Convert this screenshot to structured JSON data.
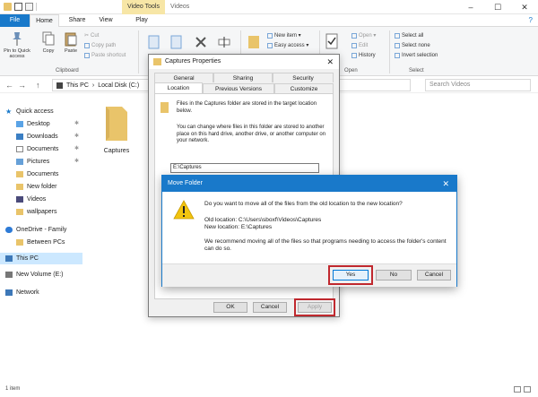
{
  "titlebar": {
    "context_tab": "Video Tools",
    "window_title": "Videos",
    "controls": [
      "–",
      "☐",
      "✕"
    ]
  },
  "tabs": {
    "file": "File",
    "home": "Home",
    "share": "Share",
    "view": "View",
    "play": "Play",
    "help": "?"
  },
  "ribbon": {
    "pin": "Pin to Quick access",
    "copy": "Copy",
    "paste": "Paste",
    "cut": "Cut",
    "copy_path": "Copy path",
    "paste_shortcut": "Paste shortcut",
    "clipboard_group": "Clipboard",
    "new_item": "New item ▾",
    "easy_access": "Easy access ▾",
    "open": "Open ▾",
    "edit": "Edit",
    "history": "History",
    "open_group": "Open",
    "select_all": "Select all",
    "select_none": "Select none",
    "invert_selection": "Invert selection",
    "select_group": "Select"
  },
  "address": {
    "back": "←",
    "forward": "→",
    "up": "↑",
    "crumbs": [
      "This PC",
      "›",
      "Local Disk (C:)"
    ],
    "search_placeholder": "Search Videos"
  },
  "navpane": {
    "items": [
      {
        "label": "Quick access",
        "pinned": false
      },
      {
        "label": "Desktop",
        "pinned": true
      },
      {
        "label": "Downloads",
        "pinned": true
      },
      {
        "label": "Documents",
        "pinned": true
      },
      {
        "label": "Pictures",
        "pinned": true
      },
      {
        "label": "Documents",
        "pinned": false
      },
      {
        "label": "New folder",
        "pinned": false
      },
      {
        "label": "Videos",
        "pinned": false
      },
      {
        "label": "wallpapers",
        "pinned": false
      },
      {
        "label": "OneDrive - Family",
        "pinned": false
      },
      {
        "label": "Between PCs",
        "pinned": false
      },
      {
        "label": "This PC",
        "pinned": false
      },
      {
        "label": "New Volume (E:)",
        "pinned": false
      },
      {
        "label": "Network",
        "pinned": false
      }
    ],
    "pin_glyph": "✱"
  },
  "content": {
    "folder_name": "Captures",
    "status": "1 item"
  },
  "properties": {
    "title": "Captures Properties",
    "close": "✕",
    "tabs_row1": [
      "General",
      "Sharing",
      "Security"
    ],
    "tabs_row2": [
      "Location",
      "Previous Versions",
      "Customize"
    ],
    "text1": "Files in the Captures folder are stored in the target location below.",
    "text2": "You can change where files in this folder are stored to another place on this hard drive, another drive, or another computer on your network.",
    "path_value": "E:\\Captures",
    "ok": "OK",
    "cancel": "Cancel",
    "apply": "Apply"
  },
  "move_dialog": {
    "title": "Move Folder",
    "close": "✕",
    "question": "Do you want to move all of the files from the old location to the new location?",
    "old_location": "Old location: C:\\Users\\sboxf\\Videos\\Captures",
    "new_location": "New location: E:\\Captures",
    "recommend": "We recommend moving all of the files so that programs needing to access the folder's content can do so.",
    "yes": "Yes",
    "no": "No",
    "cancel": "Cancel"
  },
  "colors": {
    "accent": "#1979ca",
    "highlight_red": "#c0282e",
    "folder_yellow": "#e9c46a",
    "selection": "#cce8ff"
  }
}
